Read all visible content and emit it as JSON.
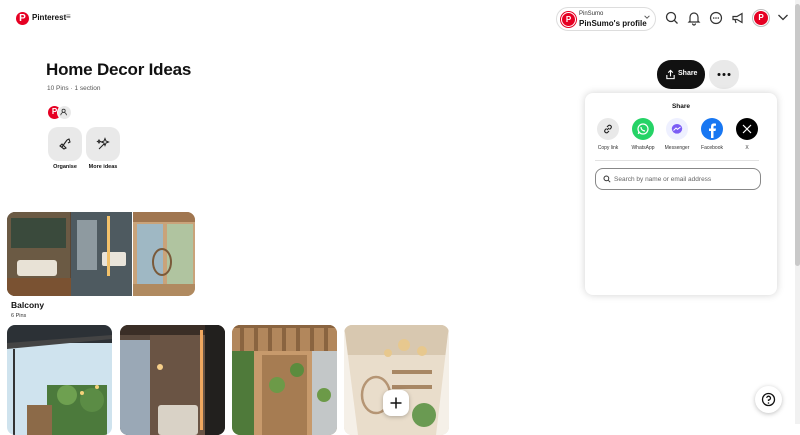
{
  "header": {
    "brand": "Pinterest",
    "brand_menu_glyph": "≡",
    "profile_switch": {
      "small_label": "PinSumo",
      "name": "PinSumo's profile",
      "avatar_letter": "P"
    },
    "icons": [
      "search-icon",
      "bell-icon",
      "messages-icon",
      "megaphone-icon",
      "user-avatar",
      "chevron-down-icon"
    ],
    "user_avatar_letter": "P"
  },
  "board": {
    "title": "Home Decor Ideas",
    "meta": "10 Pins · 1 section",
    "collaborator_letter": "P",
    "tools": [
      {
        "label": "Organise",
        "icon": "organise-icon"
      },
      {
        "label": "More ideas",
        "icon": "sparkle-icon"
      }
    ]
  },
  "actions": {
    "share_label": "Share",
    "more_icon": "ellipsis-icon"
  },
  "share_popover": {
    "title": "Share",
    "options": [
      {
        "label": "Copy link",
        "icon": "link-icon",
        "color": "#e9e9e9"
      },
      {
        "label": "WhatsApp",
        "icon": "whatsapp-icon",
        "color": "#25d366"
      },
      {
        "label": "Messenger",
        "icon": "messenger-icon",
        "color": "#eef0ff"
      },
      {
        "label": "Facebook",
        "icon": "facebook-icon",
        "color": "#1877f2"
      },
      {
        "label": "X",
        "icon": "x-icon",
        "color": "#000000"
      }
    ],
    "search_placeholder": "Search by name or email address"
  },
  "section": {
    "name": "Balcony",
    "count": "6 Pins"
  },
  "pins": [
    {
      "icon": "pin-image"
    },
    {
      "icon": "pin-image"
    },
    {
      "icon": "pin-image"
    },
    {
      "icon": "pin-image"
    }
  ],
  "colors": {
    "brand": "#e60023",
    "dark_button": "#111111",
    "light_button": "#e9e9e9"
  }
}
